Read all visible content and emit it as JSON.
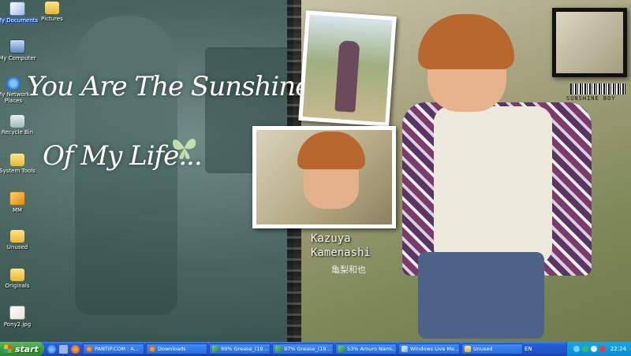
{
  "desktop": {
    "wallpaper_text": {
      "line1": "You Are The Sunshine",
      "line2": "Of My Life..."
    },
    "name_en": "Kazuya Kamenashi",
    "name_en_line1": "Kazuya",
    "name_en_line2": "Kamenashi",
    "name_jp": "亀梨和也",
    "badge": "SUNSHINE BOY",
    "icons": [
      {
        "label": "My Documents",
        "icon": "my-documents-icon",
        "selected": true
      },
      {
        "label": "Pictures",
        "icon": "folder-icon"
      },
      {
        "label": "My Computer",
        "icon": "my-computer-icon"
      },
      {
        "label": "My Network Places",
        "icon": "network-places-icon"
      },
      {
        "label": "Recycle Bin",
        "icon": "recycle-bin-icon"
      },
      {
        "label": "System Tools",
        "icon": "folder-icon"
      },
      {
        "label": "MM",
        "icon": "mm-shortcut-icon"
      },
      {
        "label": "Unused",
        "icon": "folder-icon"
      },
      {
        "label": "Originals",
        "icon": "folder-icon"
      },
      {
        "label": "Pony2.jpg",
        "icon": "jpg-file-icon"
      }
    ]
  },
  "taskbar": {
    "start_label": "start",
    "tasks": [
      {
        "label": "PANTIP.COM : A...",
        "icon": "browser-icon"
      },
      {
        "label": "Downloads",
        "icon": "browser-icon"
      },
      {
        "label": "99% Grease_(19...",
        "icon": "download-progress-icon"
      },
      {
        "label": "97% Grease_(19...",
        "icon": "download-progress-icon"
      },
      {
        "label": "53% Amuro Nami...",
        "icon": "download-progress-icon"
      },
      {
        "label": "Windows Live Me...",
        "icon": "messenger-icon"
      },
      {
        "label": "Unused",
        "icon": "folder-icon"
      }
    ],
    "language": "EN",
    "clock": "22:24"
  },
  "colors": {
    "taskbar_blue": "#245edb",
    "start_green": "#3c9d3c",
    "tray_blue": "#0c8ad8",
    "selection": "#316ac5"
  }
}
